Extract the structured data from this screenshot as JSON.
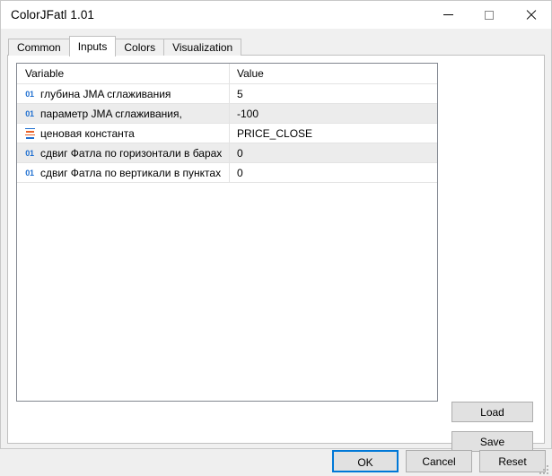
{
  "window": {
    "title": "ColorJFatl 1.01",
    "controls": {
      "minimize": "minimize-icon",
      "maximize": "maximize-icon",
      "close": "close-icon"
    }
  },
  "tabs": [
    {
      "label": "Common",
      "active": false
    },
    {
      "label": "Inputs",
      "active": true
    },
    {
      "label": "Colors",
      "active": false
    },
    {
      "label": "Visualization",
      "active": false
    }
  ],
  "table": {
    "columns": [
      "Variable",
      "Value"
    ],
    "rows": [
      {
        "icon": "integer-icon",
        "icon_label": "01",
        "variable": "глубина JMA сглаживания",
        "value": "5"
      },
      {
        "icon": "integer-icon",
        "icon_label": "01",
        "variable": "параметр JMA сглаживания,",
        "value": "-100"
      },
      {
        "icon": "enum-icon",
        "icon_label": "",
        "variable": "ценовая константа",
        "value": "PRICE_CLOSE"
      },
      {
        "icon": "integer-icon",
        "icon_label": "01",
        "variable": "сдвиг Фатла по горизонтали в барах",
        "value": "0"
      },
      {
        "icon": "integer-icon",
        "icon_label": "01",
        "variable": "сдвиг Фатла по вертикали в пунктах",
        "value": "0"
      }
    ]
  },
  "side_buttons": {
    "load": "Load",
    "save": "Save"
  },
  "footer_buttons": {
    "ok": "OK",
    "cancel": "Cancel",
    "reset": "Reset"
  },
  "colors": {
    "accent": "#0078d7",
    "integer_icon": "#1f6fd0",
    "enum_icon_alt": "#e8622a",
    "row_alt": "#ececec",
    "window_bg": "#f0f0f0"
  }
}
